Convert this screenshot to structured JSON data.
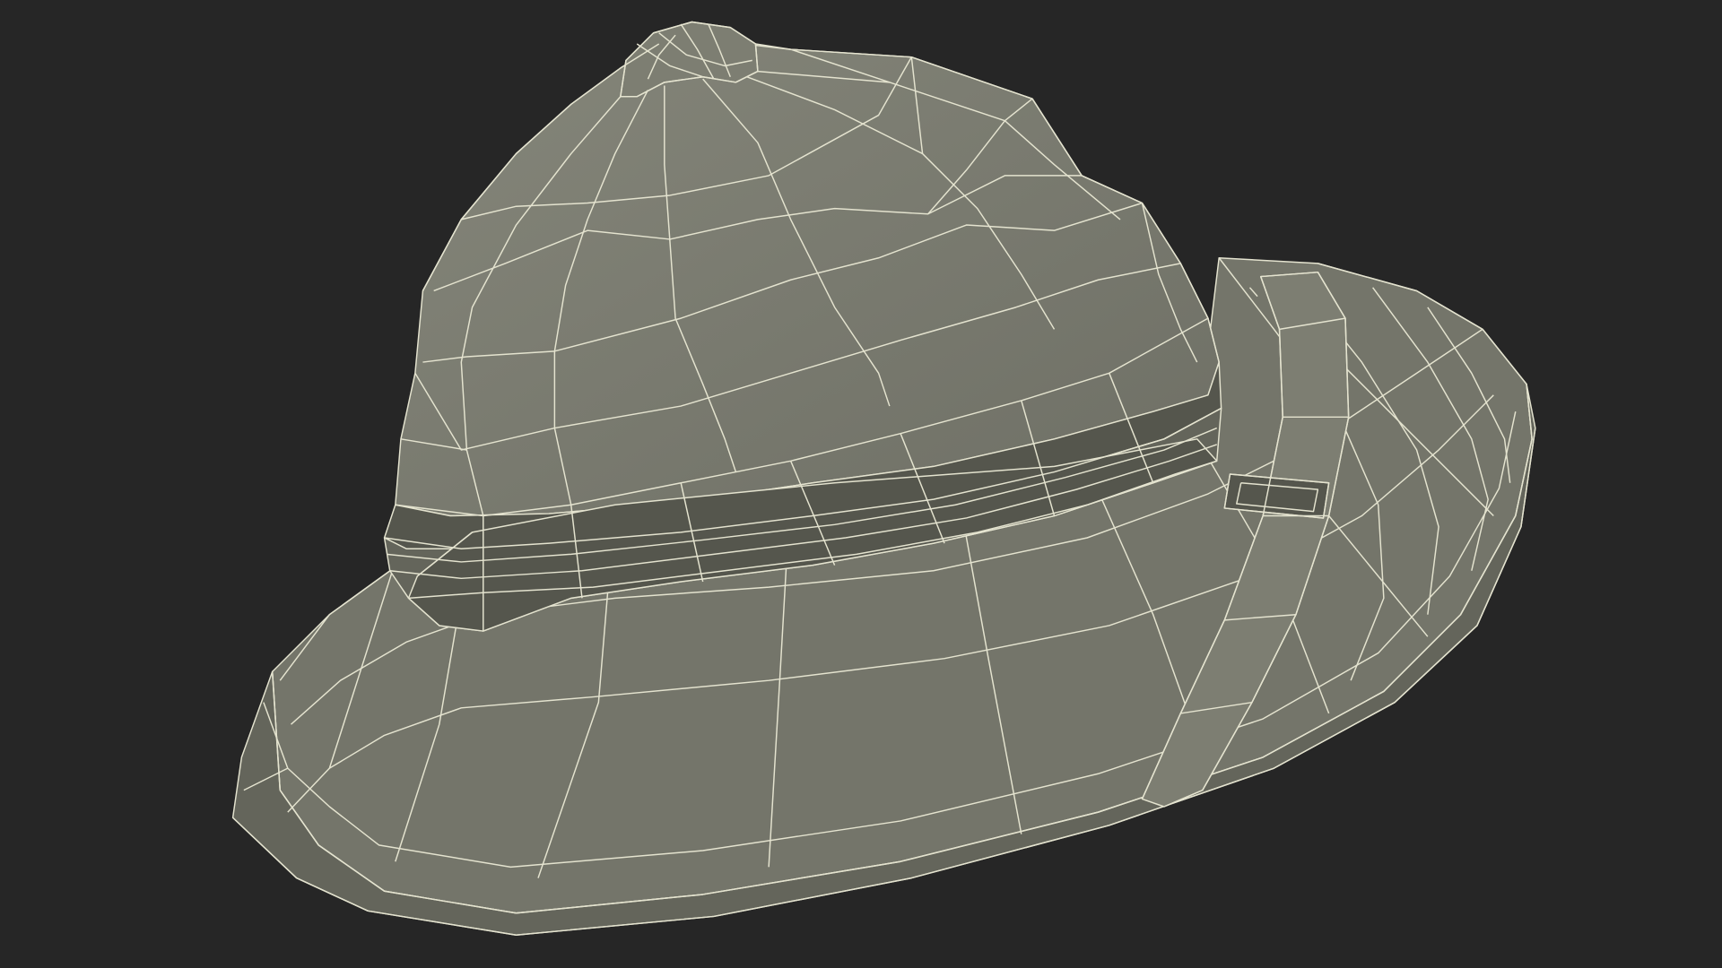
{
  "scene": {
    "subject_icon": "pith-helmet-wireframe",
    "render_style": "shaded-wireframe",
    "colors": {
      "background": "#262626",
      "surface_light": "#7d7e72",
      "surface_mid": "#74756a",
      "surface_dark": "#64655b",
      "surface_shadow": "#55564d",
      "wire": "#e4e3cf"
    }
  }
}
